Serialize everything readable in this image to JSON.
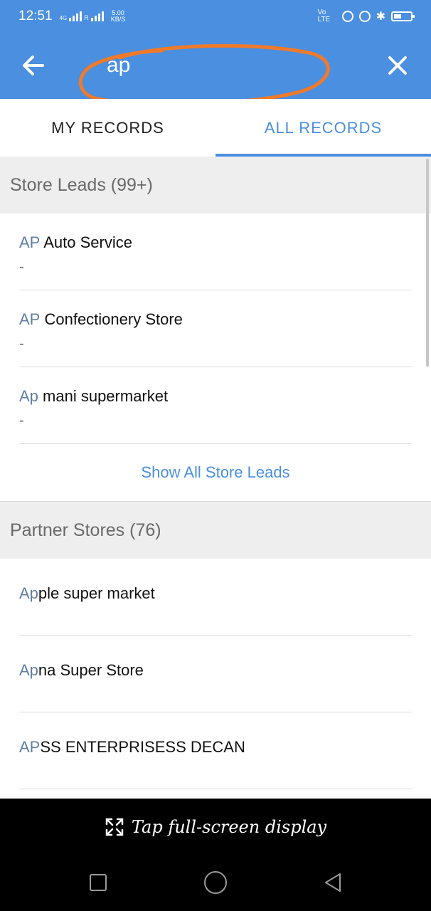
{
  "status_bar": {
    "time": "12:51",
    "network": "4G",
    "speed_value": "5.00",
    "speed_unit": "KB/S",
    "volte": "Vo LTE"
  },
  "search": {
    "query": "ap"
  },
  "tabs": [
    {
      "label": "MY RECORDS",
      "active": false
    },
    {
      "label": "ALL RECORDS",
      "active": true
    }
  ],
  "sections": {
    "store_leads": {
      "header": "Store Leads (99+)",
      "items": [
        {
          "highlight": "AP",
          "rest": " Auto Service",
          "sub": "-"
        },
        {
          "highlight": "AP",
          "rest": " Confectionery Store",
          "sub": "-"
        },
        {
          "highlight": "Ap",
          "rest": " mani supermarket",
          "sub": "-"
        }
      ],
      "show_all": "Show All Store Leads"
    },
    "partner_stores": {
      "header": "Partner Stores (76)",
      "items": [
        {
          "highlight": "Ap",
          "rest": "ple super market"
        },
        {
          "highlight": "Ap",
          "rest": "na Super Store"
        },
        {
          "highlight": "AP",
          "rest": "SS ENTERPRISESS DECAN"
        }
      ]
    }
  },
  "overlay": {
    "text": "Tap full-screen display"
  },
  "colors": {
    "accent": "#4a8fe0",
    "highlight": "#5f7ea3",
    "annotation": "#f07a2a"
  }
}
